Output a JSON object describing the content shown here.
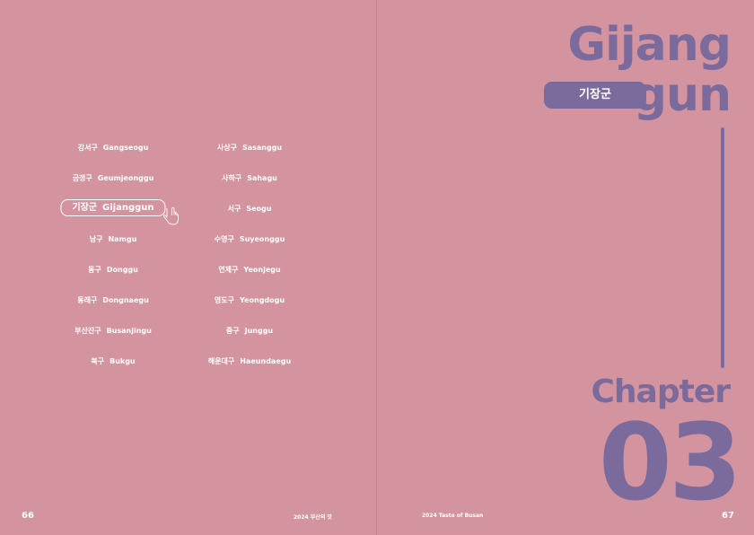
{
  "left_page": {
    "page_number": "66",
    "running_title": "2024 부산의 맛",
    "districts_col1": [
      {
        "ko": "강서구",
        "en": "Gangseogu"
      },
      {
        "ko": "금정구",
        "en": "Geumjeonggu"
      },
      {
        "ko": "기장군",
        "en": "Gijanggun"
      },
      {
        "ko": "남구",
        "en": "Namgu"
      },
      {
        "ko": "동구",
        "en": "Donggu"
      },
      {
        "ko": "동래구",
        "en": "Dongnaegu"
      },
      {
        "ko": "부산진구",
        "en": "Busanjingu"
      },
      {
        "ko": "북구",
        "en": "Bukgu"
      }
    ],
    "districts_col2": [
      {
        "ko": "사상구",
        "en": "Sasanggu"
      },
      {
        "ko": "사하구",
        "en": "Sahagu"
      },
      {
        "ko": "서구",
        "en": "Seogu"
      },
      {
        "ko": "수영구",
        "en": "Suyeonggu"
      },
      {
        "ko": "연제구",
        "en": "Yeonjegu"
      },
      {
        "ko": "영도구",
        "en": "Yeongdogu"
      },
      {
        "ko": "중구",
        "en": "Junggu"
      },
      {
        "ko": "해운대구",
        "en": "Haeundaegu"
      }
    ],
    "selected_district": "Gijanggun"
  },
  "right_page": {
    "page_number": "67",
    "running_title": "2024 Taste of Busan",
    "title_line1": "Gijang",
    "title_line2": "gun",
    "korean_label": "기장군",
    "chapter_label": "Chapter",
    "chapter_number": "03"
  },
  "colors": {
    "background": "#d3949f",
    "accent": "#7b6a9c",
    "text_light": "#ffffff"
  },
  "icons": [
    "pointing-hand-icon"
  ]
}
